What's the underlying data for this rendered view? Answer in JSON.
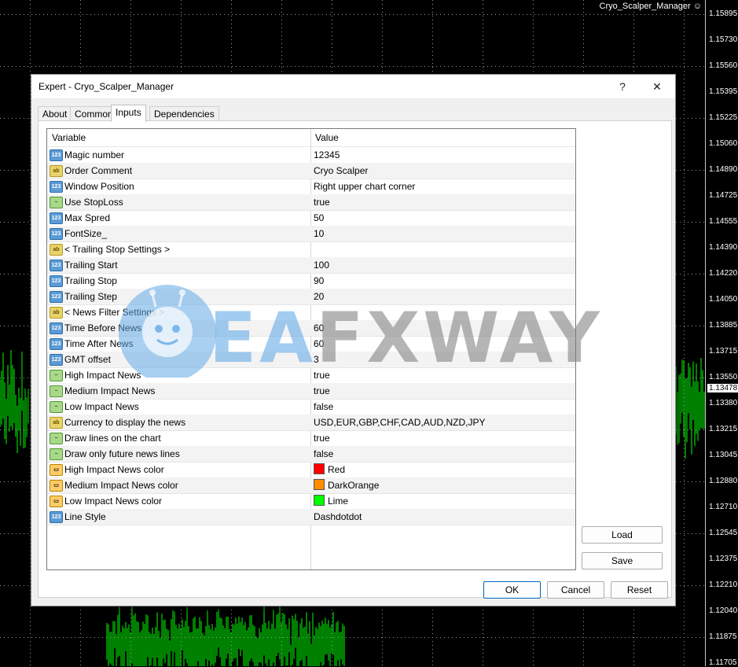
{
  "chart": {
    "ea_label": "Cryo_Scalper_Manager",
    "ea_icon": "smiley-icon",
    "current_price": "1.13478",
    "price_levels": [
      "1.15895",
      "1.15730",
      "1.15560",
      "1.15395",
      "1.15225",
      "1.15060",
      "1.14890",
      "1.14725",
      "1.14555",
      "1.14390",
      "1.14220",
      "1.14050",
      "1.13885",
      "1.13715",
      "1.13550",
      "1.13380",
      "1.13215",
      "1.13045",
      "1.12880",
      "1.12710",
      "1.12545",
      "1.12375",
      "1.12210",
      "1.12040",
      "1.11875",
      "1.11705"
    ],
    "candle_color": "#00ff00"
  },
  "dialog": {
    "title": "Expert - Cryo_Scalper_Manager",
    "help_label": "?",
    "close_label": "✕",
    "tabs": [
      {
        "label": "About"
      },
      {
        "label": "Common"
      },
      {
        "label": "Inputs"
      },
      {
        "label": "Dependencies"
      }
    ],
    "active_tab": "Inputs",
    "columns": {
      "variable": "Variable",
      "value": "Value"
    },
    "rows": [
      {
        "type": "num",
        "var": "Magic number",
        "val": "12345"
      },
      {
        "type": "str",
        "var": "Order Comment",
        "val": "Cryo Scalper"
      },
      {
        "type": "num",
        "var": "Window Position",
        "val": "Right upper chart corner"
      },
      {
        "type": "bool",
        "var": "Use StopLoss",
        "val": "true"
      },
      {
        "type": "num",
        "var": "Max Spred",
        "val": "50"
      },
      {
        "type": "num",
        "var": "FontSize_",
        "val": "10"
      },
      {
        "type": "str",
        "var": "< Trailing Stop Settings >",
        "val": ""
      },
      {
        "type": "num",
        "var": "Trailing Start",
        "val": "100"
      },
      {
        "type": "num",
        "var": "Trailing Stop",
        "val": "90"
      },
      {
        "type": "num",
        "var": "Trailing Step",
        "val": "20"
      },
      {
        "type": "str",
        "var": "< News Filter Settings >",
        "val": ""
      },
      {
        "type": "num",
        "var": "Time Before News",
        "val": "60"
      },
      {
        "type": "num",
        "var": "Time After News",
        "val": "60"
      },
      {
        "type": "num",
        "var": "GMT offset",
        "val": "3"
      },
      {
        "type": "bool",
        "var": "High Impact News",
        "val": "true"
      },
      {
        "type": "bool",
        "var": "Medium Impact News",
        "val": "true"
      },
      {
        "type": "bool",
        "var": "Low Impact News",
        "val": "false"
      },
      {
        "type": "str",
        "var": "Currency to display the news",
        "val": "USD,EUR,GBP,CHF,CAD,AUD,NZD,JPY"
      },
      {
        "type": "bool",
        "var": "Draw lines on the chart",
        "val": "true"
      },
      {
        "type": "bool",
        "var": "Draw only future news lines",
        "val": "false"
      },
      {
        "type": "color",
        "var": "High Impact News color",
        "val": "Red",
        "swatch": "#ff0000"
      },
      {
        "type": "color",
        "var": "Medium Impact News color",
        "val": "DarkOrange",
        "swatch": "#ff8c00"
      },
      {
        "type": "color",
        "var": "Low Impact News color",
        "val": "Lime",
        "swatch": "#00ff00"
      },
      {
        "type": "num",
        "var": "Line Style",
        "val": "Dashdotdot"
      }
    ],
    "buttons": {
      "load": "Load",
      "save": "Save",
      "ok": "OK",
      "cancel": "Cancel",
      "reset": "Reset"
    }
  },
  "watermark": {
    "text_a": "EA",
    "text_b": "FXWAY",
    "logo": "robot-icon"
  }
}
